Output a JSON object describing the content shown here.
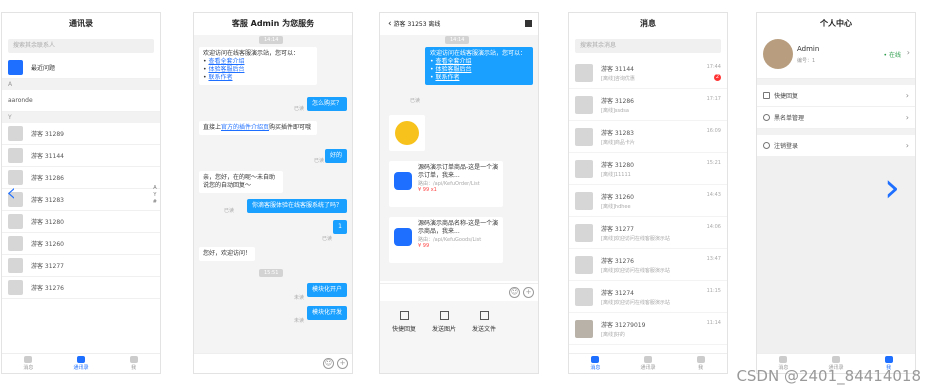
{
  "contacts": {
    "title": "通讯录",
    "search": "搜索其余联系人",
    "newfriend": "最近问题",
    "sec_a": "A",
    "a_name": "aaronde",
    "sec_y": "Y",
    "list": [
      "游客 31289",
      "游客 31144",
      "游客 31286",
      "游客 31283",
      "游客 31280",
      "游客 31260",
      "游客 31277",
      "游客 31276"
    ],
    "index": [
      "A",
      "Y",
      "#"
    ],
    "tabs": [
      "消息",
      "通讯录",
      "我"
    ]
  },
  "chat1": {
    "title": "客服 Admin 为您服务",
    "ts1": "14:14",
    "welcome": "欢迎访问在线客服演示站，您可以：",
    "links": [
      "查看全套介绍",
      "体验客服后台",
      "联系作者"
    ],
    "q1": "怎么购买？",
    "read": "已读",
    "ans1a": "直接上",
    "ans1b": "官方的插件介绍页",
    "ans1c": "购买插件即可哦",
    "ok": "好的",
    "ans2": "亲，您好，在的呢～未自助说您的自动回复～",
    "q2": "你滴客服体验在线客服系统了吗？",
    "q3": "1",
    "hello": "您好，欢迎访问！",
    "ts2": "15:51",
    "o1": "模块化开户",
    "o2": "模块化开发",
    "unread": "未读"
  },
  "chat2": {
    "title": "游客 31253 离线",
    "ts": "14:14",
    "welcome": "欢迎访问在线客服演示站，您可以：",
    "links": [
      "查看全套介绍",
      "体验客服后台",
      "联系作者"
    ],
    "read": "已读",
    "card1": {
      "t": "源码演示订单商品-这是一个演示订单，我来...",
      "p": "路由：/api/KefuOrder/List",
      "r": "¥ 99  x1"
    },
    "card2": {
      "t": "源码演示商品名称-这是一个演示商品，我来...",
      "p": "路由：/api/KefuGoods/List",
      "r": "¥ 99"
    },
    "tools": [
      "快捷回复",
      "发送图片",
      "发送文件"
    ]
  },
  "msgs": {
    "title": "消息",
    "search": "搜索其余消息",
    "rows": [
      {
        "n": "游客 31144",
        "s": "[离线]咨询优惠",
        "t": "17:44",
        "b": "2"
      },
      {
        "n": "游客 31286",
        "s": "[离线]ssdsa",
        "t": "17:17"
      },
      {
        "n": "游客 31283",
        "s": "[离线]商品卡片",
        "t": "16:09"
      },
      {
        "n": "游客 31280",
        "s": "[离线]11111",
        "t": "15:21"
      },
      {
        "n": "游客 31260",
        "s": "[离线]hdhee",
        "t": "14:43"
      },
      {
        "n": "游客 31277",
        "s": "[离线]欢迎访问在线客服演示站",
        "t": "14:06"
      },
      {
        "n": "游客 31276",
        "s": "[离线]欢迎访问在线客服演示站",
        "t": "13:47"
      },
      {
        "n": "游客 31274",
        "s": "[离线]欢迎访问在线客服演示站",
        "t": "11:15"
      },
      {
        "n": "游客 31279019",
        "s": "[离线]好的",
        "t": "11:14"
      }
    ],
    "tabs": [
      "消息",
      "通讯录",
      "我"
    ]
  },
  "me": {
    "title": "个人中心",
    "name": "Admin",
    "num": "编号：1",
    "status": "在线",
    "items": [
      "快捷回复",
      "黑名单管理",
      "注销登录"
    ],
    "tabs": [
      "消息",
      "通讯录",
      "我"
    ]
  },
  "watermark": "CSDN @2401_84414018"
}
